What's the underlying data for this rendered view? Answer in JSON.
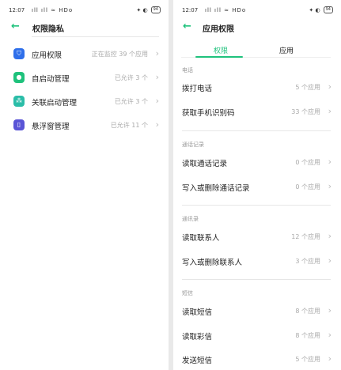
{
  "status_bar": {
    "time": "12:07",
    "signal": "ıll ıll ≈ HDo",
    "right_icons": "✦ ◐",
    "battery": "94"
  },
  "left": {
    "title": "权限隐私",
    "items": [
      {
        "label": "应用权限",
        "value": "正在监控 39 个应用",
        "icon": "shield-icon",
        "color": "#2f6fea"
      },
      {
        "label": "自启动管理",
        "value": "已允许 3 个",
        "icon": "toggle-icon",
        "color": "#1fc27c"
      },
      {
        "label": "关联启动管理",
        "value": "已允许 3 个",
        "icon": "link-icon",
        "color": "#2bbda8"
      },
      {
        "label": "悬浮窗管理",
        "value": "已允许 11 个",
        "icon": "window-icon",
        "color": "#5a55d6"
      }
    ]
  },
  "right": {
    "title": "应用权限",
    "tabs": [
      "权限",
      "应用"
    ],
    "sections": [
      {
        "header": "电话",
        "items": [
          {
            "label": "拨打电话",
            "value": "5 个应用"
          },
          {
            "label": "获取手机识别码",
            "value": "33 个应用"
          }
        ]
      },
      {
        "header": "通话记录",
        "items": [
          {
            "label": "读取通话记录",
            "value": "0 个应用"
          },
          {
            "label": "写入或删除通话记录",
            "value": "0 个应用"
          }
        ]
      },
      {
        "header": "通讯录",
        "items": [
          {
            "label": "读取联系人",
            "value": "12 个应用"
          },
          {
            "label": "写入或删除联系人",
            "value": "3 个应用"
          }
        ]
      },
      {
        "header": "短信",
        "items": [
          {
            "label": "读取短信",
            "value": "8 个应用"
          },
          {
            "label": "读取彩信",
            "value": "8 个应用"
          },
          {
            "label": "发送短信",
            "value": "5 个应用"
          }
        ]
      }
    ]
  }
}
